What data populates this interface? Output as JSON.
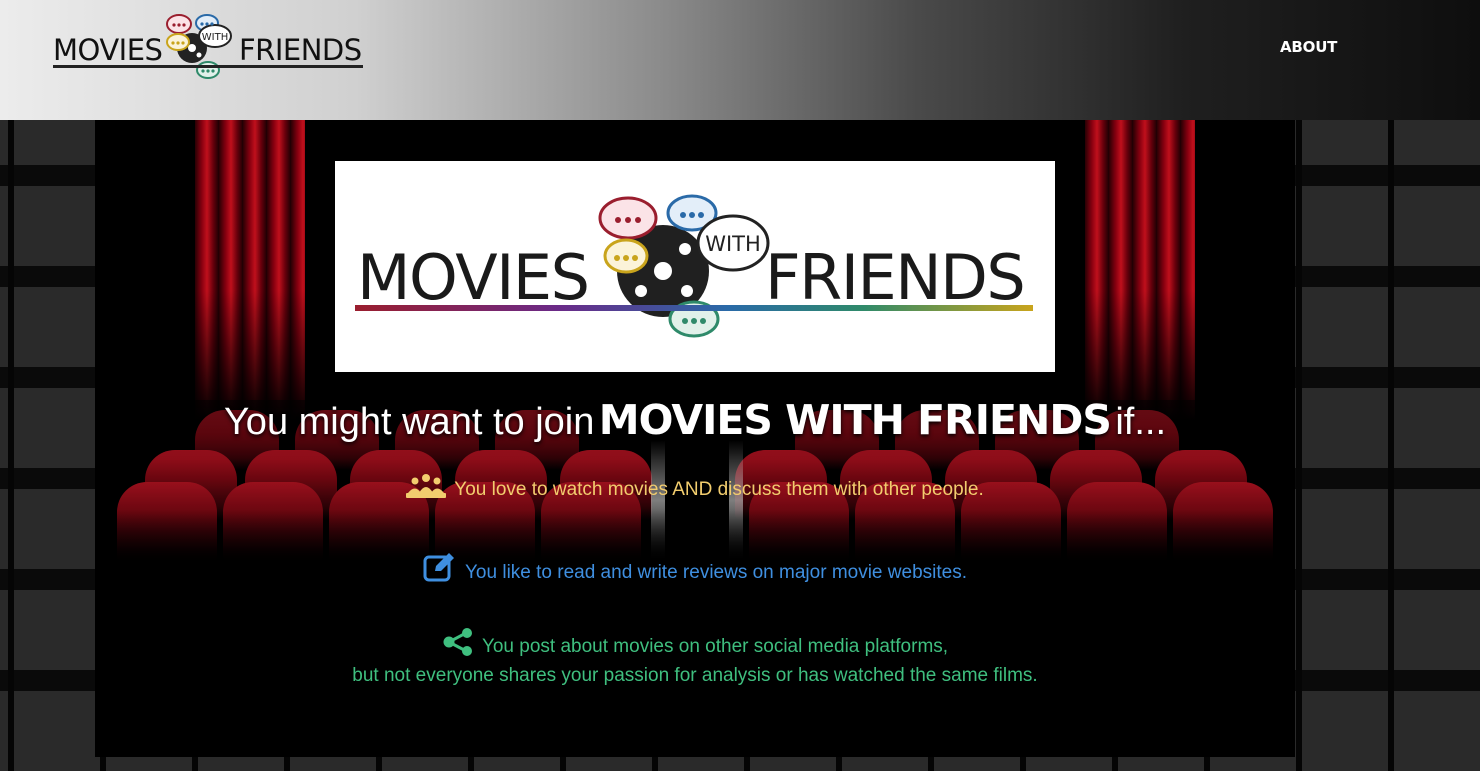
{
  "header": {
    "logo": {
      "word1": "MOVIES",
      "badge": "WITH",
      "word2": "FRIENDS"
    },
    "nav": {
      "about_label": "ABOUT"
    }
  },
  "screen_logo": {
    "word1": "MOVIES",
    "badge": "WITH",
    "word2": "FRIENDS"
  },
  "headline": {
    "prefix": "You might want to join",
    "brand": "MOVIES WITH FRIENDS",
    "suffix": "if..."
  },
  "reasons": [
    {
      "icon": "people-icon",
      "color": "#f2cd6e",
      "line1": "You love to watch movies AND discuss them with other people."
    },
    {
      "icon": "edit-icon",
      "color": "#3f8fe0",
      "line1": "You like to read and write reviews on major movie websites."
    },
    {
      "icon": "share-icon",
      "color": "#3fbf7f",
      "line1": "You post about movies on other social media platforms,",
      "line2": "but not everyone shares your passion for analysis or has watched the same films."
    }
  ],
  "colors": {
    "bubble_red": "#9a1e2e",
    "bubble_blue": "#2a6aa8",
    "bubble_gold": "#c9a41c",
    "bubble_teal": "#2f8a6a",
    "curtain_red": "#b0101c"
  }
}
